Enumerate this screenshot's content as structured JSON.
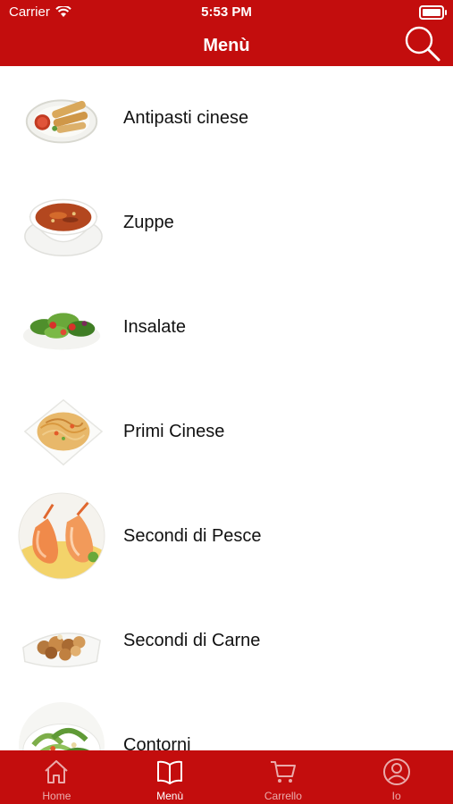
{
  "status": {
    "carrier": "Carrier",
    "time": "5:53 PM"
  },
  "nav": {
    "title": "Menù"
  },
  "menu": {
    "items": [
      {
        "label": "Antipasti cinese",
        "icon": "spring-rolls-dish-icon"
      },
      {
        "label": "Zuppe",
        "icon": "soup-bowl-icon"
      },
      {
        "label": "Insalate",
        "icon": "salad-icon"
      },
      {
        "label": "Primi Cinese",
        "icon": "noodles-plate-icon"
      },
      {
        "label": "Secondi di Pesce",
        "icon": "shrimp-dish-icon"
      },
      {
        "label": "Secondi di Carne",
        "icon": "meat-dish-icon"
      },
      {
        "label": "Contorni",
        "icon": "side-dish-icon"
      }
    ]
  },
  "tabbar": {
    "tabs": [
      {
        "label": "Home",
        "icon": "home-icon",
        "active": false
      },
      {
        "label": "Menù",
        "icon": "book-icon",
        "active": true
      },
      {
        "label": "Carrello",
        "icon": "cart-icon",
        "active": false
      },
      {
        "label": "Io",
        "icon": "user-icon",
        "active": false
      }
    ]
  },
  "colors": {
    "brand": "#c30d0d",
    "text": "#111111",
    "background": "#ffffff"
  }
}
